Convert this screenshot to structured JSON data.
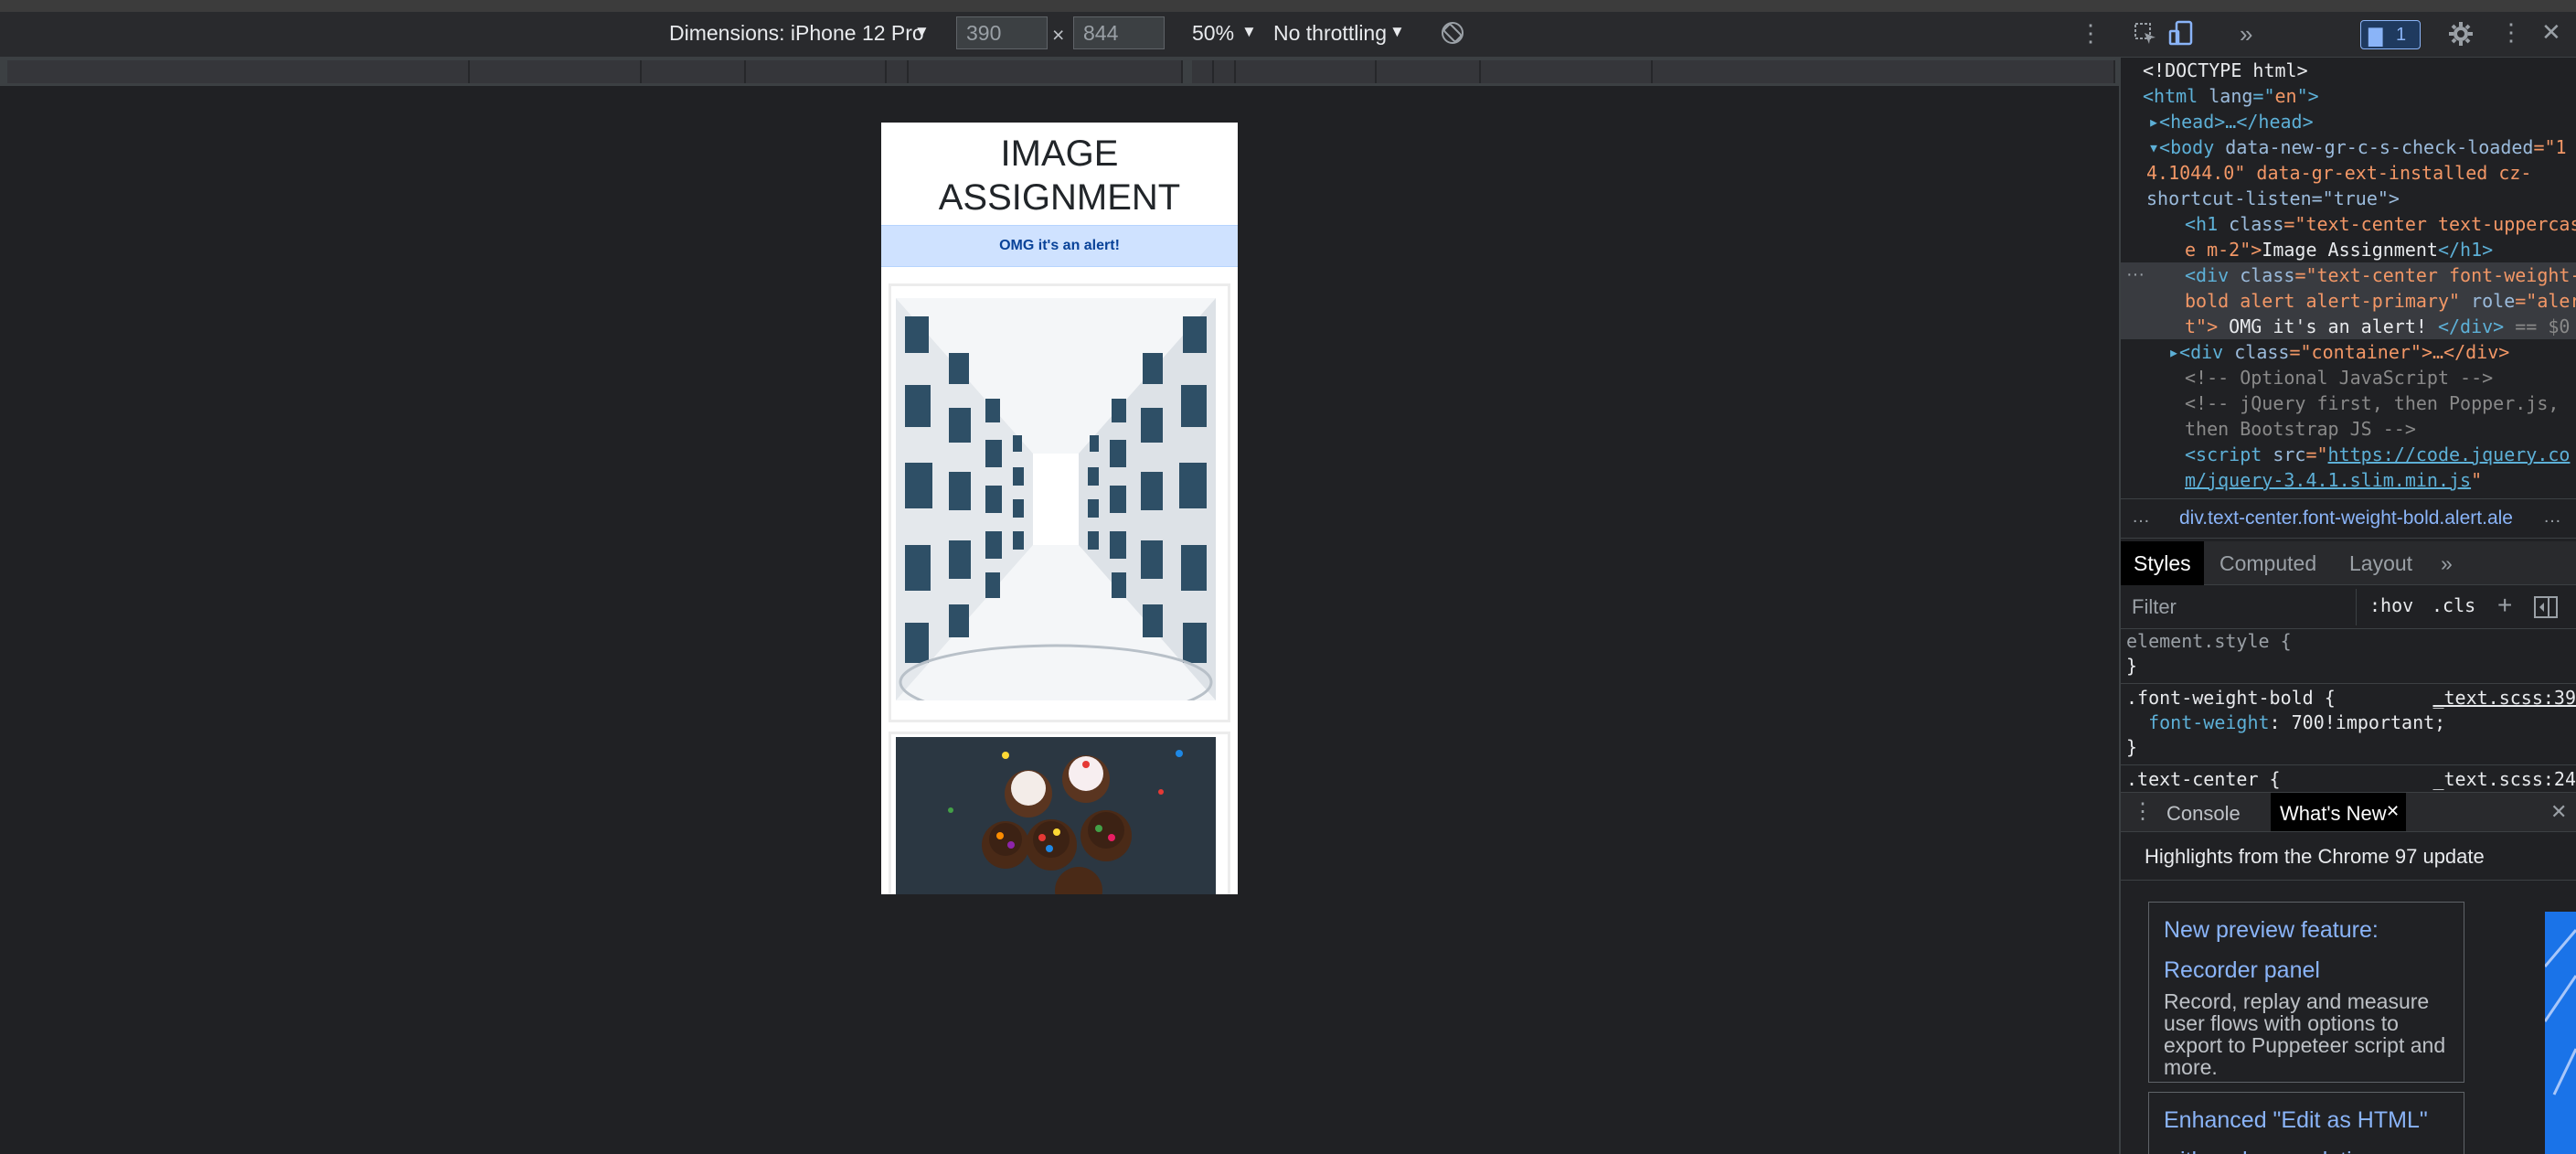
{
  "device_toolbar": {
    "dimensions_label": "Dimensions: iPhone 12 Pro",
    "width_value": "390",
    "times_sign": "×",
    "height_value": "844",
    "zoom_label": "50%",
    "throttling_label": "No throttling"
  },
  "viewport": {
    "title": "IMAGE ASSIGNMENT",
    "alert_text": "OMG it's an alert!"
  },
  "devtools": {
    "issues_count": "1",
    "elements_lines": {
      "l1": "<!DOCTYPE html>",
      "l2a": "<html ",
      "l2b": "lang",
      "l2c": "=\"",
      "l2d": "en",
      "l2e": "\">",
      "l3": "▸<head>…</head>",
      "l4a": "▾<body ",
      "l4b": "data-new-gr-c-s-check-loaded",
      "l4c": "=\"1",
      "l5": "4.1044.0\" data-gr-ext-installed cz-",
      "l6": "shortcut-listen=\"true\">",
      "l7a": "<h1 ",
      "l7b": "class",
      "l7c": "=\"text-center text-uppercas",
      "l8a": "e m-2\">",
      "l8b": "Image Assignment",
      "l8c": "</h1>",
      "l9a": "<div ",
      "l9b": "class",
      "l9c": "=\"text-center font-weight-",
      "l10a": "bold alert alert-primary\" ",
      "l10b": "role",
      "l10c": "=\"aler",
      "l11a": "t\">",
      "l11b": " OMG it's an alert! ",
      "l11c": "</div>",
      "l11d": " == $0",
      "l12a": "▸<div ",
      "l12b": "class",
      "l12c": "=\"container\">…</div>",
      "l13": "<!-- Optional JavaScript -->",
      "l14": "<!-- jQuery first, then Popper.js,",
      "l15": "then Bootstrap JS -->",
      "l16a": "<script ",
      "l16b": "src",
      "l16c": "=\"",
      "l16d": "https://code.jquery.co",
      "l17a": "m/jquery-3.4.1.slim.min.js",
      "l17b": "\""
    },
    "breadcrumb": "div.text-center.font-weight-bold.alert.ale",
    "style_tabs": [
      "Styles",
      "Computed",
      "Layout"
    ],
    "filter_placeholder": "Filter",
    "hov_label": ":hov",
    "cls_label": ".cls",
    "styles_lines": {
      "s1": "element.style {",
      "s2": "}",
      "s3": ".font-weight-bold {",
      "s3src": "_text.scss:39",
      "s4a": "  font-weight",
      "s4b": ": 700!important;",
      "s5": "}",
      "s6": ".text-center {",
      "s6src": "_text.scss:24"
    },
    "drawer_tabs": [
      "Console",
      "What's New"
    ],
    "whats_new": {
      "header": "Highlights from the Chrome 97 update",
      "card1_title_a": "New preview feature:",
      "card1_title_b": "Recorder panel",
      "card1_desc": "Record, replay and measure user flows with options to export to Puppeteer script and more.",
      "card2_title_a": "Enhanced \"Edit as HTML\"",
      "card2_title_b": "with code completion"
    }
  }
}
